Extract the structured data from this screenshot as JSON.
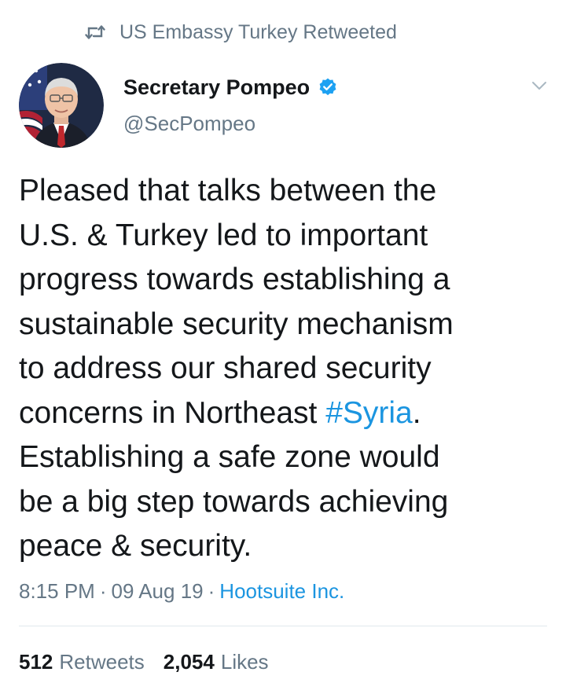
{
  "retweet_context": {
    "icon": "retweet-icon",
    "text": "US Embassy Turkey Retweeted"
  },
  "author": {
    "avatar_icon": "profile-photo",
    "name": "Secretary Pompeo",
    "verified_icon": "verified-badge-icon",
    "handle": "@SecPompeo"
  },
  "menu_icon": "chevron-down-icon",
  "tweet": {
    "text_before": "Pleased that talks between the\nU.S. & Turkey led to important\nprogress towards establishing a\nsustainable security mechanism\nto address our shared security\nconcerns in Northeast ",
    "hashtag": "#Syria",
    "text_after": ".\nEstablishing a safe zone would\nbe a big step towards achieving\npeace & security."
  },
  "meta": {
    "time": "8:15 PM",
    "separator": "·",
    "date": "09 Aug 19",
    "source": "Hootsuite Inc."
  },
  "stats": {
    "retweets_count": "512",
    "retweets_label": "Retweets",
    "likes_count": "2,054",
    "likes_label": "Likes"
  },
  "colors": {
    "link": "#1b95e0",
    "secondary_text": "#657786",
    "primary_text": "#14171a",
    "verified": "#1da1f2",
    "divider": "#e1e8ed"
  }
}
